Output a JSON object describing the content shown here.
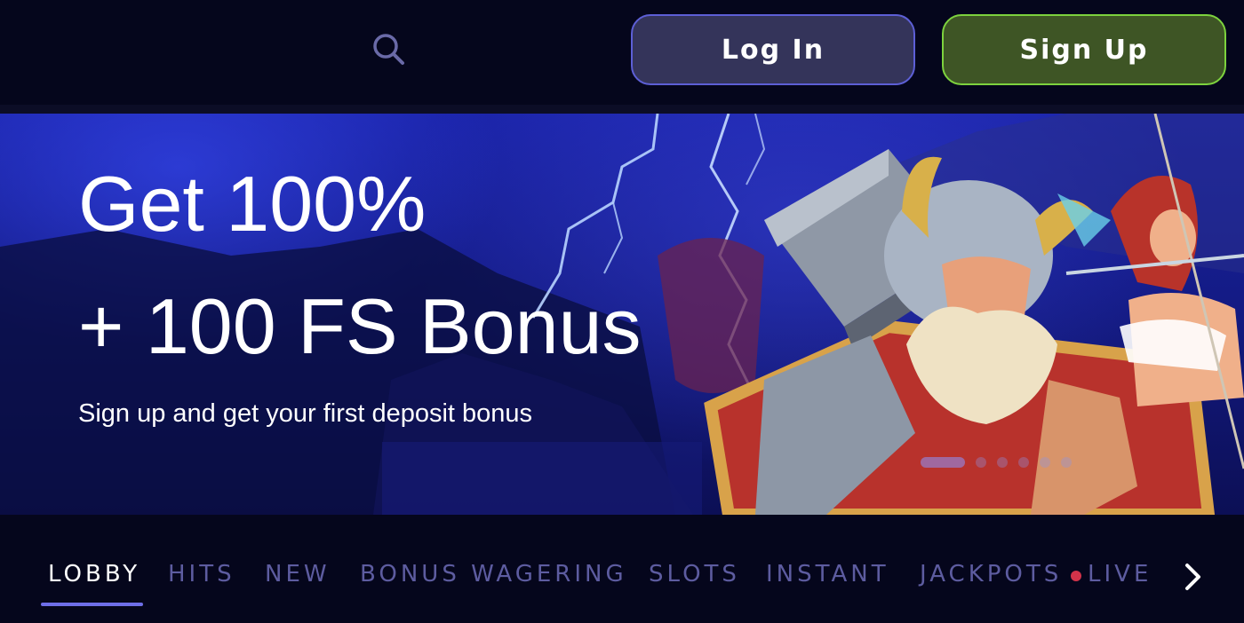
{
  "header": {
    "search_icon": "search-icon",
    "login_label": "Log In",
    "signup_label": "Sign Up"
  },
  "colors": {
    "background": "#05061c",
    "login_bg": "#34345a",
    "login_border": "#5d5fd6",
    "signup_bg": "#3e5525",
    "signup_border": "#7dd23e",
    "nav_inactive": "#5d5ca0",
    "nav_active": "#ffffff",
    "underline": "#6e6ee8",
    "live_dot": "#d2334a"
  },
  "banner": {
    "title_line1": "Get 100%",
    "title_line2": "+ 100 FS Bonus",
    "subtitle": "Sign up and get your first deposit bonus",
    "slides_total": 6,
    "active_slide": 1
  },
  "nav": {
    "items": [
      {
        "label": "LOBBY",
        "active": true
      },
      {
        "label": "HITS",
        "active": false
      },
      {
        "label": "NEW",
        "active": false
      },
      {
        "label": "BONUS WAGERING",
        "active": false
      },
      {
        "label": "SLOTS",
        "active": false
      },
      {
        "label": "INSTANT",
        "active": false
      },
      {
        "label": "JACKPOTS",
        "active": false
      },
      {
        "label": "LIVE",
        "active": false
      }
    ],
    "next_icon": "chevron-right-icon"
  }
}
